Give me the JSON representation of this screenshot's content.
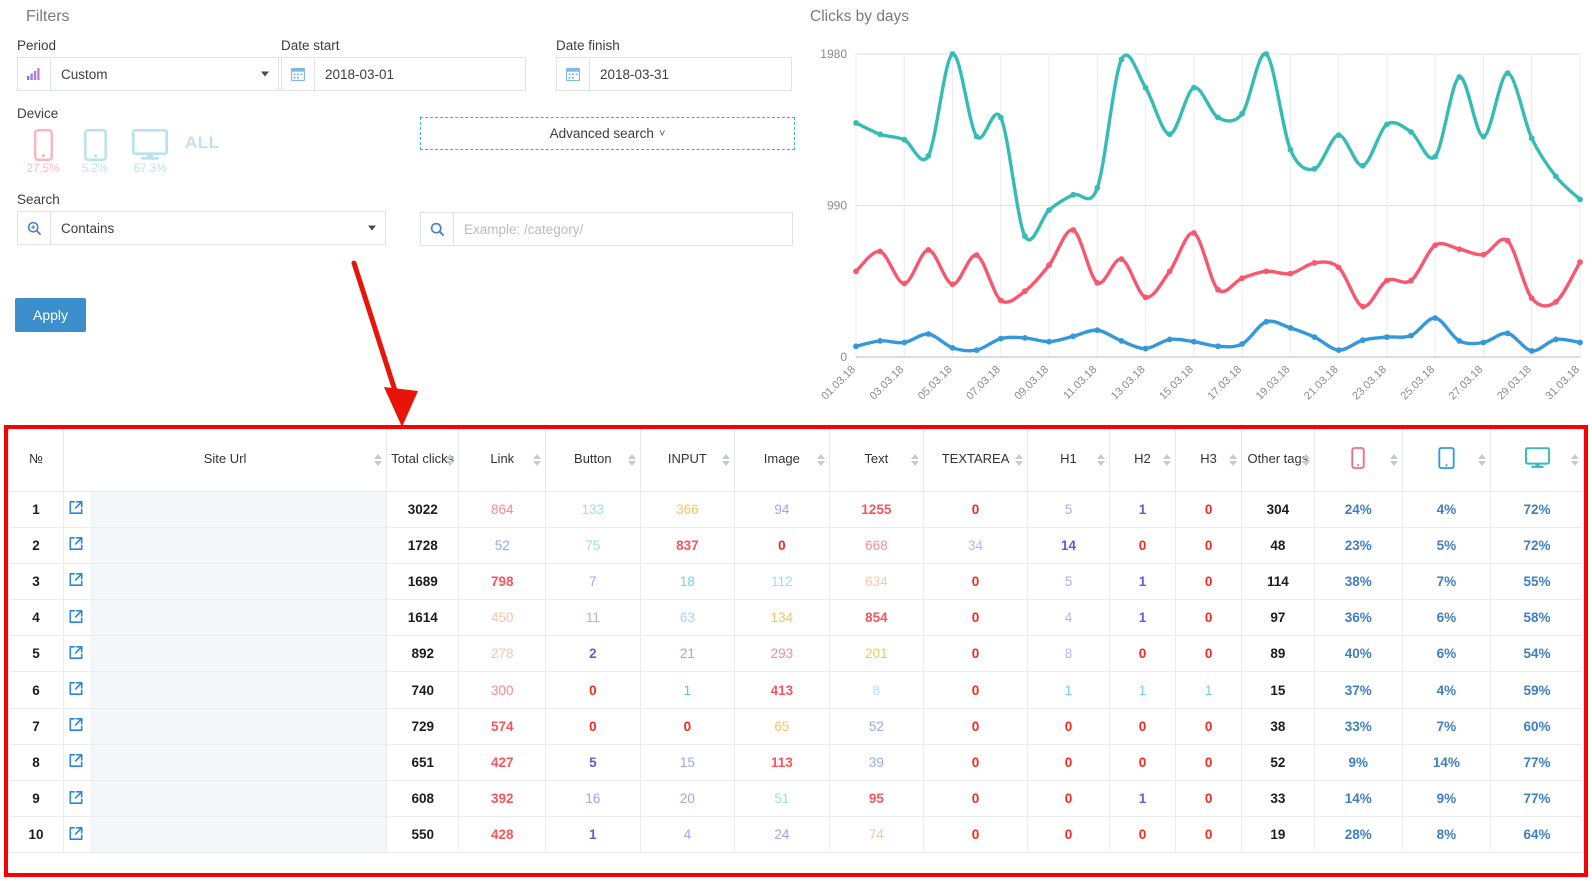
{
  "filters": {
    "title": "Filters",
    "period": {
      "label": "Period",
      "value": "Custom",
      "icon": "bar-chart-icon"
    },
    "date_start": {
      "label": "Date start",
      "value": "2018-03-01",
      "icon": "calendar-icon"
    },
    "date_finish": {
      "label": "Date finish",
      "value": "2018-03-31",
      "icon": "calendar-icon"
    },
    "device": {
      "label": "Device",
      "all_label": "ALL",
      "items": [
        {
          "icon": "mobile-icon",
          "pct": "27.5%",
          "color": "#f6a6ac"
        },
        {
          "icon": "tablet-icon",
          "pct": "5.2%",
          "color": "#a8dcf0"
        },
        {
          "icon": "desktop-icon",
          "pct": "67.3%",
          "color": "#a8dcf0"
        }
      ]
    },
    "advanced_search": {
      "label": "Advanced search",
      "chevron": "chevron-down-icon"
    },
    "search": {
      "label": "Search",
      "mode_value": "Contains",
      "mode_icon": "search-icon",
      "input_placeholder": "Example: /category/",
      "input_value": "",
      "input_icon": "search-icon"
    },
    "apply_label": "Apply"
  },
  "chart_data": {
    "type": "line",
    "title": "Clicks by days",
    "xlabel": "",
    "ylabel": "",
    "ylim": [
      0,
      1980
    ],
    "yticks": [
      0,
      990,
      1980
    ],
    "ytick_labels": [
      "0",
      "990",
      "1980"
    ],
    "grid": true,
    "legend_position": "none",
    "x": [
      "01.03.18",
      "02.03.18",
      "03.03.18",
      "04.03.18",
      "05.03.18",
      "06.03.18",
      "07.03.18",
      "08.03.18",
      "09.03.18",
      "10.03.18",
      "11.03.18",
      "12.03.18",
      "13.03.18",
      "14.03.18",
      "15.03.18",
      "16.03.18",
      "17.03.18",
      "18.03.18",
      "19.03.18",
      "20.03.18",
      "21.03.18",
      "22.03.18",
      "23.03.18",
      "24.03.18",
      "25.03.18",
      "26.03.18",
      "27.03.18",
      "28.03.18",
      "29.03.18",
      "30.03.18",
      "31.03.18"
    ],
    "xtick_labels": [
      "01.03.18",
      "03.03.18",
      "05.03.18",
      "07.03.18",
      "09.03.18",
      "11.03.18",
      "13.03.18",
      "15.03.18",
      "17.03.18",
      "19.03.18",
      "21.03.18",
      "23.03.18",
      "25.03.18",
      "27.03.18",
      "29.03.18",
      "31.03.18"
    ],
    "series": [
      {
        "name": "Desktop",
        "color": "#36bcb4",
        "values": [
          1530,
          1455,
          1420,
          1315,
          1980,
          1440,
          1565,
          790,
          960,
          1060,
          1105,
          1945,
          1760,
          1455,
          1760,
          1565,
          1590,
          1980,
          1355,
          1230,
          1450,
          1250,
          1520,
          1470,
          1310,
          1830,
          1440,
          1855,
          1430,
          1180,
          1030
        ]
      },
      {
        "name": "Mobile",
        "color": "#f7576f",
        "values": [
          560,
          690,
          480,
          700,
          475,
          665,
          370,
          430,
          600,
          830,
          485,
          640,
          390,
          560,
          810,
          440,
          515,
          560,
          545,
          615,
          585,
          330,
          500,
          500,
          730,
          705,
          670,
          760,
          385,
          360,
          620
        ]
      },
      {
        "name": "Tablet",
        "color": "#3498db",
        "values": [
          70,
          105,
          95,
          150,
          60,
          45,
          120,
          125,
          100,
          135,
          175,
          105,
          55,
          115,
          100,
          70,
          85,
          230,
          190,
          130,
          45,
          110,
          130,
          140,
          255,
          105,
          95,
          155,
          40,
          115,
          95
        ]
      }
    ]
  },
  "table": {
    "columns": [
      {
        "key": "no",
        "label": "№",
        "sortable": false,
        "width": "3.5%",
        "icon": null
      },
      {
        "key": "url",
        "label": "Site Url",
        "sortable": true,
        "width": "20.5%",
        "icon": null
      },
      {
        "key": "total",
        "label": "Total clicks",
        "sortable": true,
        "width": "4.6%",
        "icon": null
      },
      {
        "key": "link",
        "label": "Link",
        "sortable": true,
        "width": "5.5%",
        "icon": null
      },
      {
        "key": "button",
        "label": "Button",
        "sortable": true,
        "width": "6.0%",
        "icon": null
      },
      {
        "key": "input",
        "label": "INPUT",
        "sortable": true,
        "width": "6.0%",
        "icon": null
      },
      {
        "key": "image",
        "label": "Image",
        "sortable": true,
        "width": "6.0%",
        "icon": null
      },
      {
        "key": "text",
        "label": "Text",
        "sortable": true,
        "width": "6.0%",
        "icon": null
      },
      {
        "key": "textarea",
        "label": "TEXTAREA",
        "sortable": true,
        "width": "6.6%",
        "icon": null
      },
      {
        "key": "h1",
        "label": "H1",
        "sortable": true,
        "width": "5.2%",
        "icon": null
      },
      {
        "key": "h2",
        "label": "H2",
        "sortable": true,
        "width": "4.2%",
        "icon": null
      },
      {
        "key": "h3",
        "label": "H3",
        "sortable": true,
        "width": "4.2%",
        "icon": null
      },
      {
        "key": "othertags",
        "label": "Other tags",
        "sortable": true,
        "width": "4.6%",
        "icon": null
      },
      {
        "key": "mobile",
        "label": "",
        "sortable": true,
        "width": "5.6%",
        "icon": "mobile-icon"
      },
      {
        "key": "tablet",
        "label": "",
        "sortable": true,
        "width": "5.6%",
        "icon": "tablet-icon"
      },
      {
        "key": "desktop",
        "label": "",
        "sortable": true,
        "width": "5.9%",
        "icon": "desktop-icon"
      }
    ],
    "row_link_icon": "external-link-icon",
    "rows": [
      {
        "no": "1",
        "url": "",
        "total": "3022",
        "link": {
          "v": "864",
          "c": "#f98a8f"
        },
        "button": {
          "v": "133",
          "c": "#9fdcec"
        },
        "input": {
          "v": "366",
          "c": "#f7c360"
        },
        "image": {
          "v": "94",
          "c": "#9aa8e8"
        },
        "text": {
          "v": "1255",
          "c": "#f4565e",
          "b": true
        },
        "textarea": {
          "v": "0",
          "c": "#f02a1e",
          "b": true
        },
        "h1": {
          "v": "5",
          "c": "#a9b2ea"
        },
        "h2": {
          "v": "1",
          "c": "#5b5fd6",
          "b": true
        },
        "h3": {
          "v": "0",
          "c": "#f02a1e",
          "b": true
        },
        "othertags": "304",
        "mobile": "24%",
        "tablet": "4%",
        "desktop": "72%"
      },
      {
        "no": "2",
        "url": "",
        "total": "1728",
        "link": {
          "v": "52",
          "c": "#9aa8e8"
        },
        "button": {
          "v": "75",
          "c": "#9fdcec"
        },
        "input": {
          "v": "837",
          "c": "#f4565e",
          "b": true
        },
        "image": {
          "v": "0",
          "c": "#f02a1e",
          "b": true
        },
        "text": {
          "v": "668",
          "c": "#fa9097"
        },
        "textarea": {
          "v": "34",
          "c": "#b0b8ec"
        },
        "h1": {
          "v": "14",
          "c": "#5b5fd6",
          "b": true
        },
        "h2": {
          "v": "0",
          "c": "#f02a1e",
          "b": true
        },
        "h3": {
          "v": "0",
          "c": "#f02a1e",
          "b": true
        },
        "othertags": "48",
        "mobile": "23%",
        "tablet": "5%",
        "desktop": "72%"
      },
      {
        "no": "3",
        "url": "",
        "total": "1689",
        "link": {
          "v": "798",
          "c": "#f4565e",
          "b": true
        },
        "button": {
          "v": "7",
          "c": "#9aa8e8"
        },
        "input": {
          "v": "18",
          "c": "#72cfe8"
        },
        "image": {
          "v": "112",
          "c": "#9fdcec"
        },
        "text": {
          "v": "634",
          "c": "#f7c9a8"
        },
        "textarea": {
          "v": "0",
          "c": "#f02a1e",
          "b": true
        },
        "h1": {
          "v": "5",
          "c": "#a9b2ea"
        },
        "h2": {
          "v": "1",
          "c": "#5b5fd6",
          "b": true
        },
        "h3": {
          "v": "0",
          "c": "#f02a1e",
          "b": true
        },
        "othertags": "114",
        "mobile": "38%",
        "tablet": "7%",
        "desktop": "55%"
      },
      {
        "no": "4",
        "url": "",
        "total": "1614",
        "link": {
          "v": "450",
          "c": "#fac3a0"
        },
        "button": {
          "v": "11",
          "c": "#a9b2ea"
        },
        "input": {
          "v": "63",
          "c": "#9fdcec"
        },
        "image": {
          "v": "134",
          "c": "#f7c360"
        },
        "text": {
          "v": "854",
          "c": "#f4565e",
          "b": true
        },
        "textarea": {
          "v": "0",
          "c": "#f02a1e",
          "b": true
        },
        "h1": {
          "v": "4",
          "c": "#b0b8ec"
        },
        "h2": {
          "v": "1",
          "c": "#5b5fd6",
          "b": true
        },
        "h3": {
          "v": "0",
          "c": "#f02a1e",
          "b": true
        },
        "othertags": "97",
        "mobile": "36%",
        "tablet": "6%",
        "desktop": "58%"
      },
      {
        "no": "5",
        "url": "",
        "total": "892",
        "link": {
          "v": "278",
          "c": "#fac3a0"
        },
        "button": {
          "v": "2",
          "c": "#5b5fd6",
          "b": true
        },
        "input": {
          "v": "21",
          "c": "#9aa8e8"
        },
        "image": {
          "v": "293",
          "c": "#f98a8f"
        },
        "text": {
          "v": "201",
          "c": "#f7c360"
        },
        "textarea": {
          "v": "0",
          "c": "#f02a1e",
          "b": true
        },
        "h1": {
          "v": "8",
          "c": "#b0b8ec"
        },
        "h2": {
          "v": "0",
          "c": "#f02a1e",
          "b": true
        },
        "h3": {
          "v": "0",
          "c": "#f02a1e",
          "b": true
        },
        "othertags": "89",
        "mobile": "40%",
        "tablet": "6%",
        "desktop": "54%"
      },
      {
        "no": "6",
        "url": "",
        "total": "740",
        "link": {
          "v": "300",
          "c": "#f98a8f"
        },
        "button": {
          "v": "0",
          "c": "#f02a1e",
          "b": true
        },
        "input": {
          "v": "1",
          "c": "#50c8e8"
        },
        "image": {
          "v": "413",
          "c": "#f4565e",
          "b": true
        },
        "text": {
          "v": "8",
          "c": "#b8e4f2"
        },
        "textarea": {
          "v": "0",
          "c": "#f02a1e",
          "b": true
        },
        "h1": {
          "v": "1",
          "c": "#72cfe8"
        },
        "h2": {
          "v": "1",
          "c": "#72cfe8"
        },
        "h3": {
          "v": "1",
          "c": "#72cfe8"
        },
        "othertags": "15",
        "mobile": "37%",
        "tablet": "4%",
        "desktop": "59%"
      },
      {
        "no": "7",
        "url": "",
        "total": "729",
        "link": {
          "v": "574",
          "c": "#f4565e",
          "b": true
        },
        "button": {
          "v": "0",
          "c": "#f02a1e",
          "b": true
        },
        "input": {
          "v": "0",
          "c": "#f02a1e",
          "b": true
        },
        "image": {
          "v": "65",
          "c": "#f7c360"
        },
        "text": {
          "v": "52",
          "c": "#9aa8e8"
        },
        "textarea": {
          "v": "0",
          "c": "#f02a1e",
          "b": true
        },
        "h1": {
          "v": "0",
          "c": "#f02a1e",
          "b": true
        },
        "h2": {
          "v": "0",
          "c": "#f02a1e",
          "b": true
        },
        "h3": {
          "v": "0",
          "c": "#f02a1e",
          "b": true
        },
        "othertags": "38",
        "mobile": "33%",
        "tablet": "7%",
        "desktop": "60%"
      },
      {
        "no": "8",
        "url": "",
        "total": "651",
        "link": {
          "v": "427",
          "c": "#f4565e",
          "b": true
        },
        "button": {
          "v": "5",
          "c": "#5b5fd6",
          "b": true
        },
        "input": {
          "v": "15",
          "c": "#9aa8e8"
        },
        "image": {
          "v": "113",
          "c": "#f4565e",
          "b": true
        },
        "text": {
          "v": "39",
          "c": "#9aa8e8"
        },
        "textarea": {
          "v": "0",
          "c": "#f02a1e",
          "b": true
        },
        "h1": {
          "v": "0",
          "c": "#f02a1e",
          "b": true
        },
        "h2": {
          "v": "0",
          "c": "#f02a1e",
          "b": true
        },
        "h3": {
          "v": "0",
          "c": "#f02a1e",
          "b": true
        },
        "othertags": "52",
        "mobile": "9%",
        "tablet": "14%",
        "desktop": "77%"
      },
      {
        "no": "9",
        "url": "",
        "total": "608",
        "link": {
          "v": "392",
          "c": "#f4565e",
          "b": true
        },
        "button": {
          "v": "16",
          "c": "#9aa8e8"
        },
        "input": {
          "v": "20",
          "c": "#9aa8e8"
        },
        "image": {
          "v": "51",
          "c": "#9fdcec"
        },
        "text": {
          "v": "95",
          "c": "#f4565e",
          "b": true
        },
        "textarea": {
          "v": "0",
          "c": "#f02a1e",
          "b": true
        },
        "h1": {
          "v": "0",
          "c": "#f02a1e",
          "b": true
        },
        "h2": {
          "v": "1",
          "c": "#5b5fd6",
          "b": true
        },
        "h3": {
          "v": "0",
          "c": "#f02a1e",
          "b": true
        },
        "othertags": "33",
        "mobile": "14%",
        "tablet": "9%",
        "desktop": "77%"
      },
      {
        "no": "10",
        "url": "",
        "total": "550",
        "link": {
          "v": "428",
          "c": "#f4565e",
          "b": true
        },
        "button": {
          "v": "1",
          "c": "#5b5fd6",
          "b": true
        },
        "input": {
          "v": "4",
          "c": "#9aa8e8"
        },
        "image": {
          "v": "24",
          "c": "#9aa8e8"
        },
        "text": {
          "v": "74",
          "c": "#fac3a0"
        },
        "textarea": {
          "v": "0",
          "c": "#f02a1e",
          "b": true
        },
        "h1": {
          "v": "0",
          "c": "#f02a1e",
          "b": true
        },
        "h2": {
          "v": "0",
          "c": "#f02a1e",
          "b": true
        },
        "h3": {
          "v": "0",
          "c": "#f02a1e",
          "b": true
        },
        "othertags": "19",
        "mobile": "28%",
        "tablet": "8%",
        "desktop": "64%"
      }
    ],
    "percent_color": "#3d7fc1",
    "border_highlight_color": "#f80000"
  },
  "annotations": {
    "arrow": {
      "color": "#e81309",
      "name": "red-arrow-annotation"
    },
    "table_highlight": {
      "color": "#f80000"
    }
  }
}
